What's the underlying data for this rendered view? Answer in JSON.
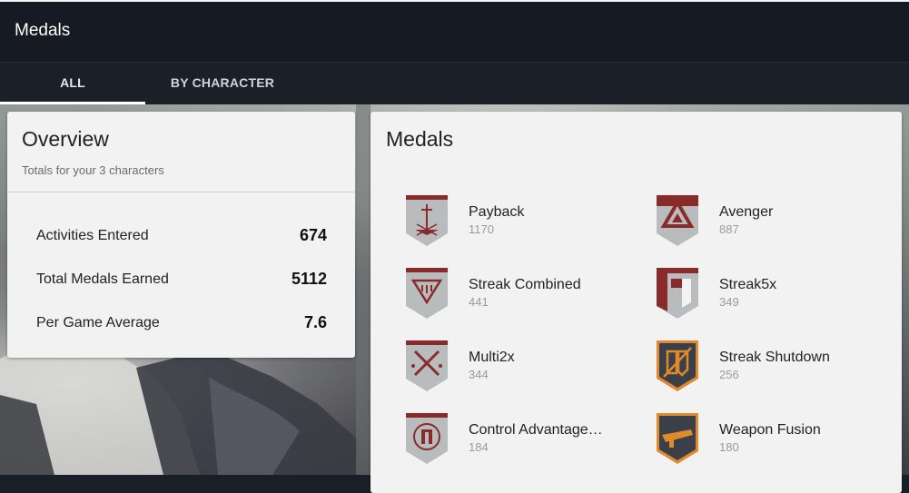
{
  "header": {
    "title": "Medals"
  },
  "tabs": [
    {
      "label": "ALL",
      "active": true
    },
    {
      "label": "BY CHARACTER",
      "active": false
    }
  ],
  "overview": {
    "heading": "Overview",
    "subtitle": "Totals for your 3 characters",
    "stats": [
      {
        "label": "Activities Entered",
        "value": "674"
      },
      {
        "label": "Total Medals Earned",
        "value": "5112"
      },
      {
        "label": "Per Game Average",
        "value": "7.6"
      }
    ]
  },
  "medals": {
    "heading": "Medals",
    "items": [
      {
        "name": "Payback",
        "count": "1170",
        "icon": "payback-medal-icon",
        "style": "crimson"
      },
      {
        "name": "Avenger",
        "count": "887",
        "icon": "avenger-medal-icon",
        "style": "crimson"
      },
      {
        "name": "Streak Combined",
        "count": "441",
        "icon": "streak-combined-medal-icon",
        "style": "crimson"
      },
      {
        "name": "Streak5x",
        "count": "349",
        "icon": "streak5x-medal-icon",
        "style": "crimson"
      },
      {
        "name": "Multi2x",
        "count": "344",
        "icon": "multi2x-medal-icon",
        "style": "crimson"
      },
      {
        "name": "Streak Shutdown",
        "count": "256",
        "icon": "streak-shutdown-medal-icon",
        "style": "orange"
      },
      {
        "name": "Control Advantage…",
        "count": "184",
        "icon": "control-advantage-medal-icon",
        "style": "crimson"
      },
      {
        "name": "Weapon Fusion",
        "count": "180",
        "icon": "weapon-fusion-medal-icon",
        "style": "orange"
      }
    ]
  },
  "colors": {
    "crimson": "#8b2a2a",
    "orange": "#e08a2c",
    "badge_gray": "#b9bcbd",
    "dark_badge": "#3a3f4a"
  }
}
